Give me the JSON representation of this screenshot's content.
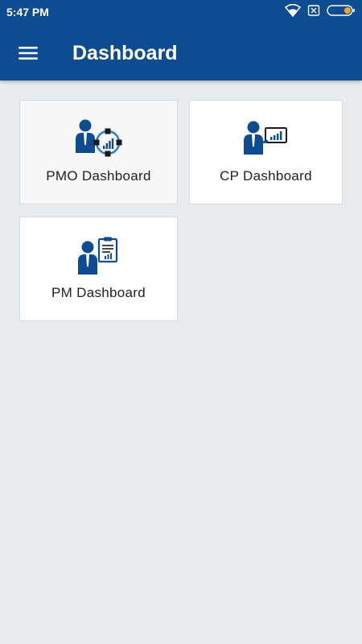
{
  "status_bar": {
    "time": "5:47 PM",
    "icons": [
      "wifi-icon",
      "sim-none-icon",
      "battery-icon"
    ]
  },
  "app_bar": {
    "menu_icon": "hamburger-menu-icon",
    "title": "Dashboard"
  },
  "cards": [
    {
      "label": "PMO Dashboard",
      "icon": "pmo-network-person-icon"
    },
    {
      "label": "CP Dashboard",
      "icon": "cp-presentation-person-icon"
    },
    {
      "label": "PM Dashboard",
      "icon": "pm-clipboard-person-icon"
    }
  ],
  "colors": {
    "primary": "#0e4c92",
    "background": "#e8ecef",
    "card": "#ffffff",
    "battery_fill": "#f5a623"
  }
}
